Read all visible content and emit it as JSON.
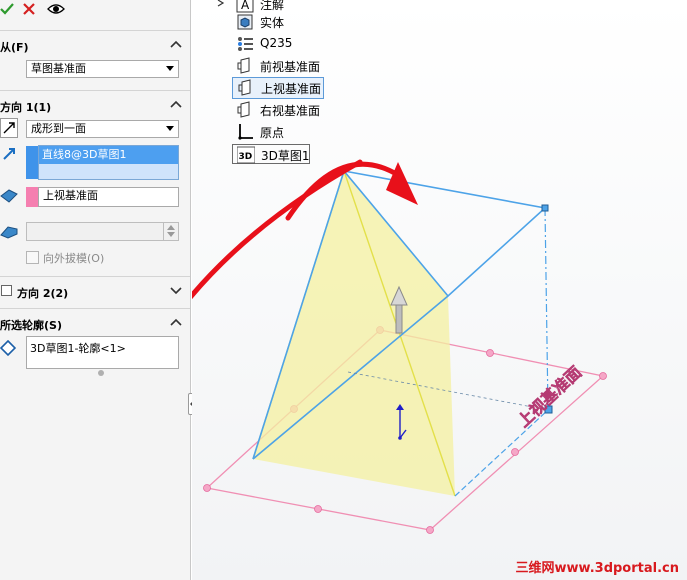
{
  "panel": {
    "toolbar": {
      "ok_icon": "check-icon",
      "cancel_icon": "x-icon",
      "preview_icon": "eye-icon"
    },
    "from": {
      "header": "从(F)",
      "start_condition": "草图基准面"
    },
    "direction1": {
      "header": "方向 1(1)",
      "end_condition": "成形到一面",
      "direction_ref": "直线8@3D草图1",
      "face": "上视基准面",
      "draft_outward": "向外拔模(O)"
    },
    "direction2": {
      "header": "方向 2(2)"
    },
    "selected_contours": {
      "header": "所选轮廓(S)",
      "item": "3D草图1-轮廓<1>"
    }
  },
  "tree": {
    "items": [
      {
        "label": "注解",
        "icon": "annotation-icon"
      },
      {
        "label": "实体",
        "icon": "solid-bodies-icon"
      },
      {
        "label": "Q235",
        "icon": "material-icon"
      },
      {
        "label": "前视基准面",
        "icon": "plane-icon"
      },
      {
        "label": "上视基准面",
        "icon": "plane-icon"
      },
      {
        "label": "右视基准面",
        "icon": "plane-icon"
      },
      {
        "label": "原点",
        "icon": "origin-icon"
      },
      {
        "label": "3D草图1",
        "icon": "sketch3d-icon"
      }
    ]
  },
  "viewport": {
    "plane_label": "上视基准面",
    "watermark": "三维网www.3dportal.cn"
  },
  "colors": {
    "accent": "#3399ff",
    "selection_fill": "#cfe3fb",
    "face_pink": "#f08fb3",
    "preview_fill": "#f4f0a0",
    "arrow_red": "#e8101a",
    "sketch_blue": "#4da3e8"
  }
}
